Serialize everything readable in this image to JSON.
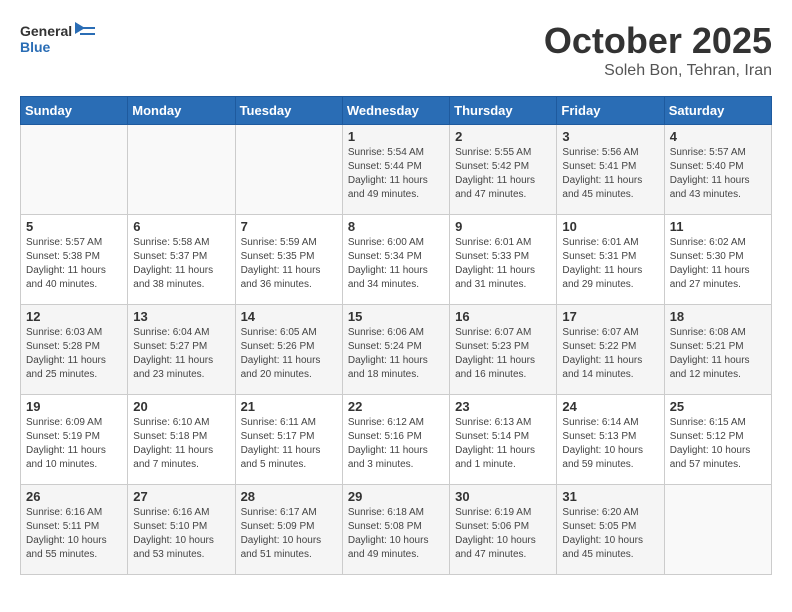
{
  "logo": {
    "general": "General",
    "blue": "Blue"
  },
  "title": "October 2025",
  "subtitle": "Soleh Bon, Tehran, Iran",
  "headers": [
    "Sunday",
    "Monday",
    "Tuesday",
    "Wednesday",
    "Thursday",
    "Friday",
    "Saturday"
  ],
  "weeks": [
    [
      {
        "day": "",
        "sunrise": "",
        "sunset": "",
        "daylight": ""
      },
      {
        "day": "",
        "sunrise": "",
        "sunset": "",
        "daylight": ""
      },
      {
        "day": "",
        "sunrise": "",
        "sunset": "",
        "daylight": ""
      },
      {
        "day": "1",
        "sunrise": "Sunrise: 5:54 AM",
        "sunset": "Sunset: 5:44 PM",
        "daylight": "Daylight: 11 hours and 49 minutes."
      },
      {
        "day": "2",
        "sunrise": "Sunrise: 5:55 AM",
        "sunset": "Sunset: 5:42 PM",
        "daylight": "Daylight: 11 hours and 47 minutes."
      },
      {
        "day": "3",
        "sunrise": "Sunrise: 5:56 AM",
        "sunset": "Sunset: 5:41 PM",
        "daylight": "Daylight: 11 hours and 45 minutes."
      },
      {
        "day": "4",
        "sunrise": "Sunrise: 5:57 AM",
        "sunset": "Sunset: 5:40 PM",
        "daylight": "Daylight: 11 hours and 43 minutes."
      }
    ],
    [
      {
        "day": "5",
        "sunrise": "Sunrise: 5:57 AM",
        "sunset": "Sunset: 5:38 PM",
        "daylight": "Daylight: 11 hours and 40 minutes."
      },
      {
        "day": "6",
        "sunrise": "Sunrise: 5:58 AM",
        "sunset": "Sunset: 5:37 PM",
        "daylight": "Daylight: 11 hours and 38 minutes."
      },
      {
        "day": "7",
        "sunrise": "Sunrise: 5:59 AM",
        "sunset": "Sunset: 5:35 PM",
        "daylight": "Daylight: 11 hours and 36 minutes."
      },
      {
        "day": "8",
        "sunrise": "Sunrise: 6:00 AM",
        "sunset": "Sunset: 5:34 PM",
        "daylight": "Daylight: 11 hours and 34 minutes."
      },
      {
        "day": "9",
        "sunrise": "Sunrise: 6:01 AM",
        "sunset": "Sunset: 5:33 PM",
        "daylight": "Daylight: 11 hours and 31 minutes."
      },
      {
        "day": "10",
        "sunrise": "Sunrise: 6:01 AM",
        "sunset": "Sunset: 5:31 PM",
        "daylight": "Daylight: 11 hours and 29 minutes."
      },
      {
        "day": "11",
        "sunrise": "Sunrise: 6:02 AM",
        "sunset": "Sunset: 5:30 PM",
        "daylight": "Daylight: 11 hours and 27 minutes."
      }
    ],
    [
      {
        "day": "12",
        "sunrise": "Sunrise: 6:03 AM",
        "sunset": "Sunset: 5:28 PM",
        "daylight": "Daylight: 11 hours and 25 minutes."
      },
      {
        "day": "13",
        "sunrise": "Sunrise: 6:04 AM",
        "sunset": "Sunset: 5:27 PM",
        "daylight": "Daylight: 11 hours and 23 minutes."
      },
      {
        "day": "14",
        "sunrise": "Sunrise: 6:05 AM",
        "sunset": "Sunset: 5:26 PM",
        "daylight": "Daylight: 11 hours and 20 minutes."
      },
      {
        "day": "15",
        "sunrise": "Sunrise: 6:06 AM",
        "sunset": "Sunset: 5:24 PM",
        "daylight": "Daylight: 11 hours and 18 minutes."
      },
      {
        "day": "16",
        "sunrise": "Sunrise: 6:07 AM",
        "sunset": "Sunset: 5:23 PM",
        "daylight": "Daylight: 11 hours and 16 minutes."
      },
      {
        "day": "17",
        "sunrise": "Sunrise: 6:07 AM",
        "sunset": "Sunset: 5:22 PM",
        "daylight": "Daylight: 11 hours and 14 minutes."
      },
      {
        "day": "18",
        "sunrise": "Sunrise: 6:08 AM",
        "sunset": "Sunset: 5:21 PM",
        "daylight": "Daylight: 11 hours and 12 minutes."
      }
    ],
    [
      {
        "day": "19",
        "sunrise": "Sunrise: 6:09 AM",
        "sunset": "Sunset: 5:19 PM",
        "daylight": "Daylight: 11 hours and 10 minutes."
      },
      {
        "day": "20",
        "sunrise": "Sunrise: 6:10 AM",
        "sunset": "Sunset: 5:18 PM",
        "daylight": "Daylight: 11 hours and 7 minutes."
      },
      {
        "day": "21",
        "sunrise": "Sunrise: 6:11 AM",
        "sunset": "Sunset: 5:17 PM",
        "daylight": "Daylight: 11 hours and 5 minutes."
      },
      {
        "day": "22",
        "sunrise": "Sunrise: 6:12 AM",
        "sunset": "Sunset: 5:16 PM",
        "daylight": "Daylight: 11 hours and 3 minutes."
      },
      {
        "day": "23",
        "sunrise": "Sunrise: 6:13 AM",
        "sunset": "Sunset: 5:14 PM",
        "daylight": "Daylight: 11 hours and 1 minute."
      },
      {
        "day": "24",
        "sunrise": "Sunrise: 6:14 AM",
        "sunset": "Sunset: 5:13 PM",
        "daylight": "Daylight: 10 hours and 59 minutes."
      },
      {
        "day": "25",
        "sunrise": "Sunrise: 6:15 AM",
        "sunset": "Sunset: 5:12 PM",
        "daylight": "Daylight: 10 hours and 57 minutes."
      }
    ],
    [
      {
        "day": "26",
        "sunrise": "Sunrise: 6:16 AM",
        "sunset": "Sunset: 5:11 PM",
        "daylight": "Daylight: 10 hours and 55 minutes."
      },
      {
        "day": "27",
        "sunrise": "Sunrise: 6:16 AM",
        "sunset": "Sunset: 5:10 PM",
        "daylight": "Daylight: 10 hours and 53 minutes."
      },
      {
        "day": "28",
        "sunrise": "Sunrise: 6:17 AM",
        "sunset": "Sunset: 5:09 PM",
        "daylight": "Daylight: 10 hours and 51 minutes."
      },
      {
        "day": "29",
        "sunrise": "Sunrise: 6:18 AM",
        "sunset": "Sunset: 5:08 PM",
        "daylight": "Daylight: 10 hours and 49 minutes."
      },
      {
        "day": "30",
        "sunrise": "Sunrise: 6:19 AM",
        "sunset": "Sunset: 5:06 PM",
        "daylight": "Daylight: 10 hours and 47 minutes."
      },
      {
        "day": "31",
        "sunrise": "Sunrise: 6:20 AM",
        "sunset": "Sunset: 5:05 PM",
        "daylight": "Daylight: 10 hours and 45 minutes."
      },
      {
        "day": "",
        "sunrise": "",
        "sunset": "",
        "daylight": ""
      }
    ]
  ]
}
